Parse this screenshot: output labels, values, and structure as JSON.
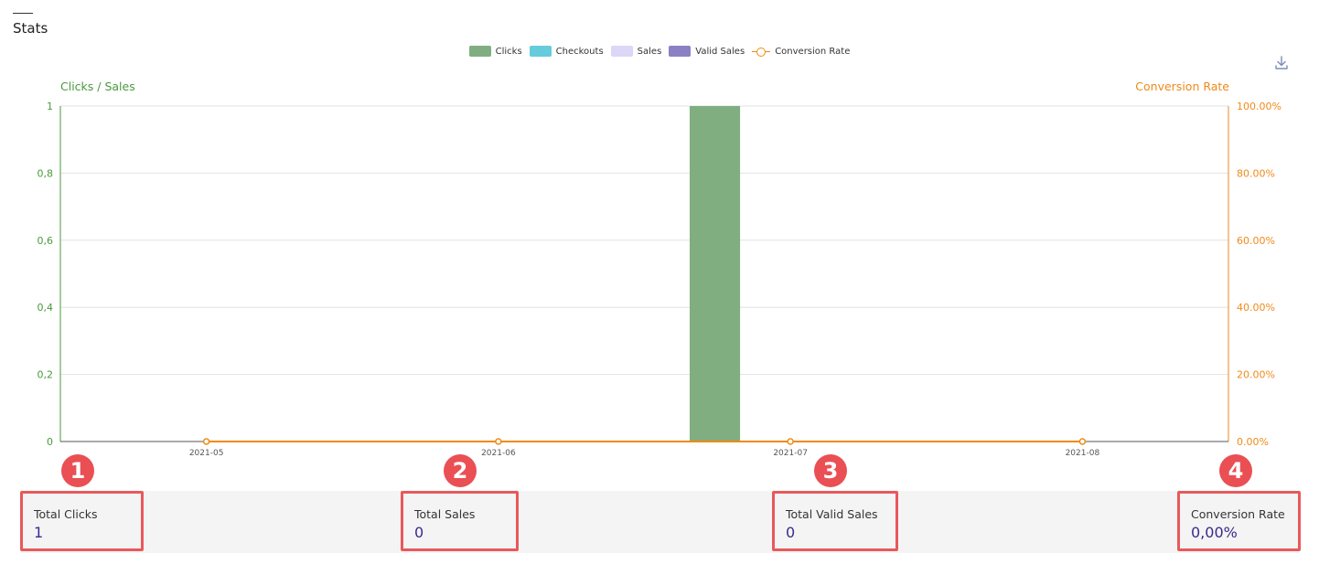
{
  "header": {
    "title": "Stats"
  },
  "legend": [
    {
      "label": "Clicks",
      "color": "#80ae80",
      "kind": "bar"
    },
    {
      "label": "Checkouts",
      "color": "#66cbda",
      "kind": "bar"
    },
    {
      "label": "Sales",
      "color": "#dcd6f7",
      "kind": "bar"
    },
    {
      "label": "Valid Sales",
      "color": "#8c80c4",
      "kind": "bar"
    },
    {
      "label": "Conversion Rate",
      "color": "#f08a12",
      "kind": "line"
    }
  ],
  "icons": {
    "download": "download-icon"
  },
  "chart_data": {
    "type": "bar",
    "categories": [
      "2021-05",
      "2021-06",
      "2021-07",
      "2021-08"
    ],
    "series": [
      {
        "name": "Clicks",
        "axis": "left",
        "values": [
          0,
          0,
          1,
          0
        ],
        "color": "#80ae80"
      },
      {
        "name": "Checkouts",
        "axis": "left",
        "values": [
          0,
          0,
          0,
          0
        ],
        "color": "#66cbda"
      },
      {
        "name": "Sales",
        "axis": "left",
        "values": [
          0,
          0,
          0,
          0
        ],
        "color": "#dcd6f7"
      },
      {
        "name": "Valid Sales",
        "axis": "left",
        "values": [
          0,
          0,
          0,
          0
        ],
        "color": "#8c80c4"
      },
      {
        "name": "Conversion Rate",
        "axis": "right",
        "type": "line",
        "values": [
          0,
          0,
          0,
          0
        ],
        "color": "#f08a12"
      }
    ],
    "ylabel_left": "Clicks / Sales",
    "ylabel_right": "Conversion Rate",
    "ylim_left": [
      0,
      1
    ],
    "ylim_right": [
      0,
      100
    ],
    "yticks_left": [
      "0",
      "0,2",
      "0,4",
      "0,6",
      "0,8",
      "1"
    ],
    "yticks_right": [
      "0.00%",
      "20.00%",
      "40.00%",
      "60.00%",
      "80.00%",
      "100.00%"
    ],
    "grid": true,
    "legend_position": "top-center"
  },
  "stats": [
    {
      "badge": "1",
      "label": "Total Clicks",
      "value": "1"
    },
    {
      "badge": "2",
      "label": "Total Sales",
      "value": "0"
    },
    {
      "badge": "3",
      "label": "Total Valid Sales",
      "value": "0"
    },
    {
      "badge": "4",
      "label": "Conversion Rate",
      "value": "0,00%"
    }
  ]
}
